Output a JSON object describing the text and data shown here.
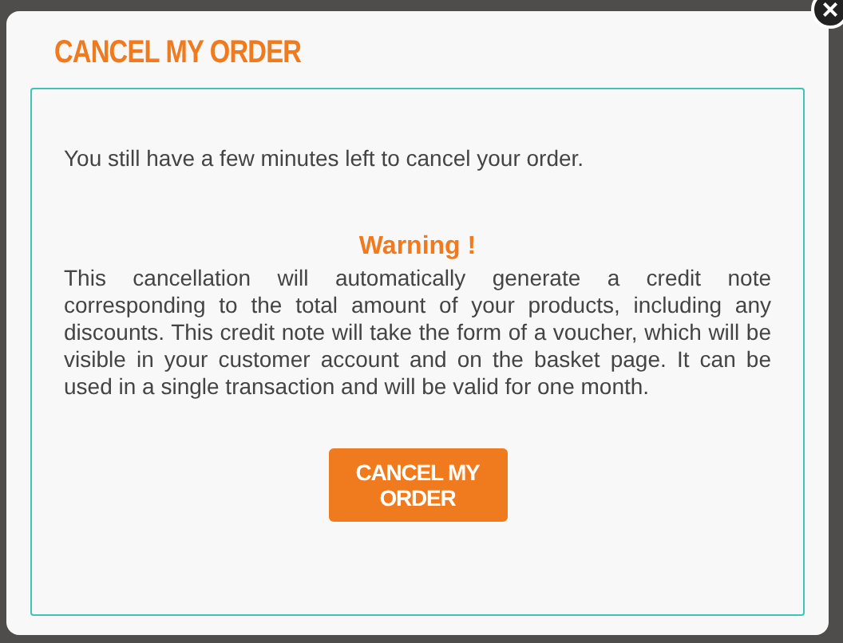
{
  "dialog": {
    "title": "CANCEL MY ORDER",
    "close_label": "×",
    "intro": "You still have a few minutes left to cancel your order.",
    "warning_title": "Warning !",
    "warning_text": "This cancellation will automatically generate a credit note corresponding to the total amount of your products, including any discounts. This credit note will take the form of a voucher, which will be visible in your customer account and on the basket page. It can be used in a single transaction and will be valid for one month.",
    "button": "CANCEL MY ORDER"
  }
}
